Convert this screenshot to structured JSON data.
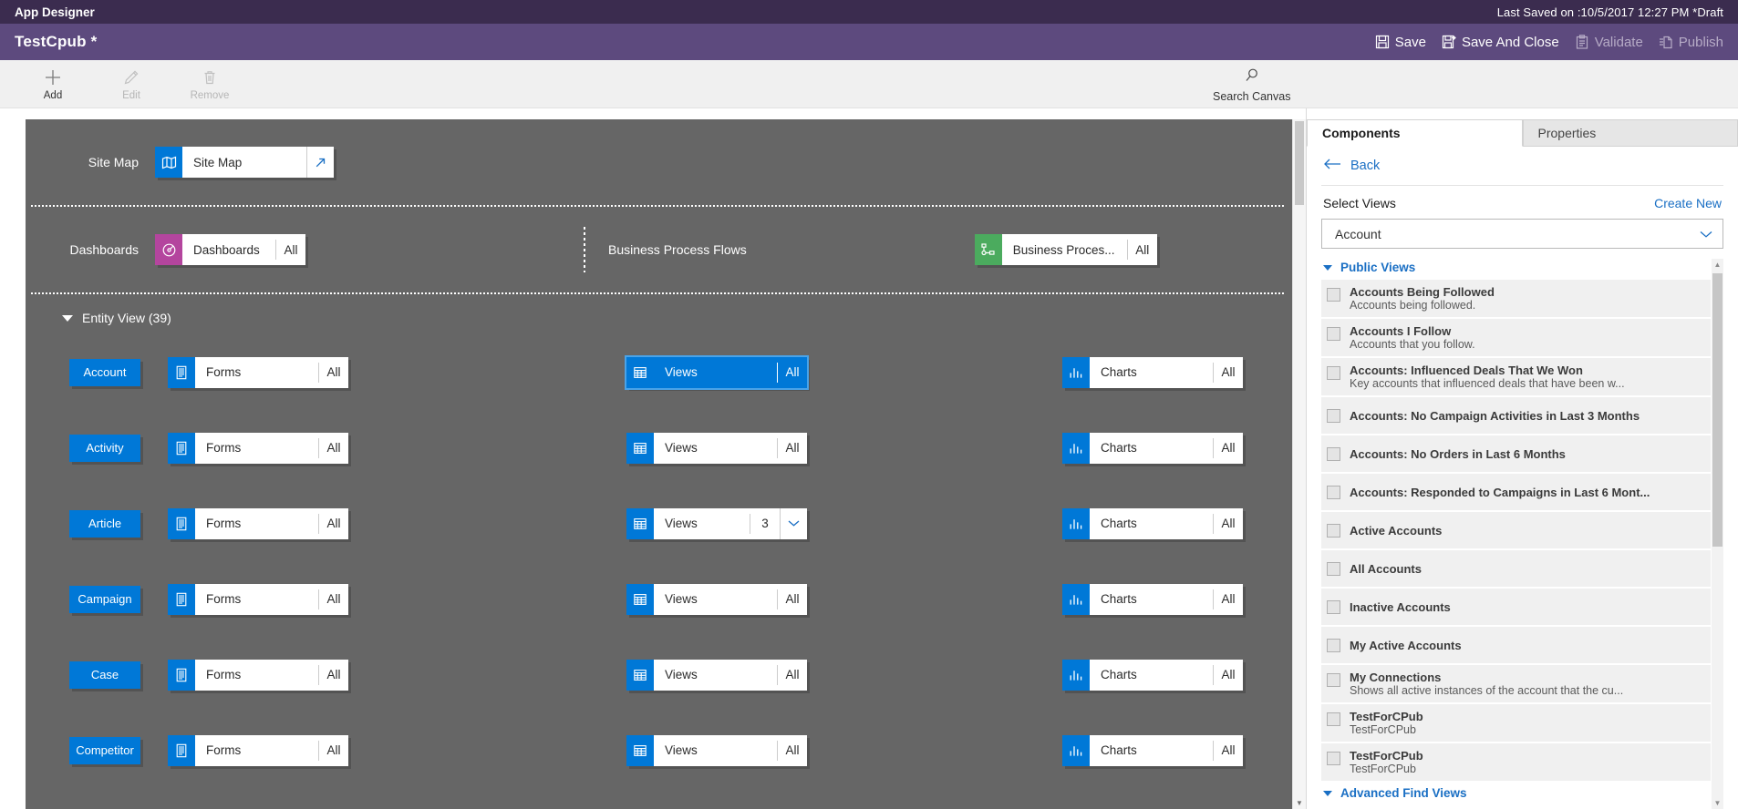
{
  "titlebar": {
    "title": "App Designer",
    "last_saved": "Last Saved on :10/5/2017 12:27 PM *Draft"
  },
  "commandbar": {
    "app_name": "TestCpub *",
    "actions": [
      {
        "label": "Save",
        "icon": "save-icon",
        "enabled": true
      },
      {
        "label": "Save And Close",
        "icon": "save-and-close-icon",
        "enabled": true
      },
      {
        "label": "Validate",
        "icon": "validate-icon",
        "enabled": false
      },
      {
        "label": "Publish",
        "icon": "publish-icon",
        "enabled": false
      }
    ]
  },
  "ribbon": {
    "buttons": [
      {
        "label": "Add",
        "icon": "plus-icon",
        "enabled": true
      },
      {
        "label": "Edit",
        "icon": "pencil-icon",
        "enabled": false
      },
      {
        "label": "Remove",
        "icon": "trash-icon",
        "enabled": false
      }
    ],
    "search_canvas": {
      "label": "Search Canvas",
      "icon": "search-icon"
    }
  },
  "canvas": {
    "sitemap_row": {
      "label": "Site Map",
      "tile": {
        "name": "Site Map",
        "icon": "map-icon",
        "icon_color": "#0078d7",
        "open_icon": "open-arrow-icon"
      }
    },
    "dashboards_row": {
      "label": "Dashboards",
      "tile": {
        "name": "Dashboards",
        "count": "All",
        "icon": "dashboard-icon",
        "icon_color": "#b4459e"
      }
    },
    "bpf_row": {
      "label": "Business Process Flows",
      "tile": {
        "name": "Business Proces...",
        "count": "All",
        "icon": "process-flow-icon",
        "icon_color": "#4bab5e"
      }
    },
    "entity_view": {
      "group_label": "Entity View (39)",
      "column_icons": {
        "forms": "forms-icon",
        "views": "views-grid-icon",
        "charts": "charts-bar-icon"
      },
      "column_labels": {
        "forms": "Forms",
        "views": "Views",
        "charts": "Charts"
      },
      "rows": [
        {
          "entity": "Account",
          "forms_count": "All",
          "views_count": "All",
          "charts_count": "All",
          "views_selected": true,
          "views_has_chevron": false
        },
        {
          "entity": "Activity",
          "forms_count": "All",
          "views_count": "All",
          "charts_count": "All",
          "views_selected": false,
          "views_has_chevron": false
        },
        {
          "entity": "Article",
          "forms_count": "All",
          "views_count": "3",
          "charts_count": "All",
          "views_selected": false,
          "views_has_chevron": true
        },
        {
          "entity": "Campaign",
          "forms_count": "All",
          "views_count": "All",
          "charts_count": "All",
          "views_selected": false,
          "views_has_chevron": false
        },
        {
          "entity": "Case",
          "forms_count": "All",
          "views_count": "All",
          "charts_count": "All",
          "views_selected": false,
          "views_has_chevron": false
        },
        {
          "entity": "Competitor",
          "forms_count": "All",
          "views_count": "All",
          "charts_count": "All",
          "views_selected": false,
          "views_has_chevron": false
        }
      ]
    }
  },
  "panel": {
    "tabs": [
      {
        "label": "Components",
        "active": true
      },
      {
        "label": "Properties",
        "active": false
      }
    ],
    "back_label": "Back",
    "select_label": "Select Views",
    "create_new_label": "Create New",
    "entity_combo_value": "Account",
    "groups": [
      {
        "label": "Public Views",
        "expanded": true,
        "items": [
          {
            "title": "Accounts Being Followed",
            "desc": "Accounts being followed.",
            "checked": false
          },
          {
            "title": "Accounts I Follow",
            "desc": "Accounts that you follow.",
            "checked": false
          },
          {
            "title": "Accounts: Influenced Deals That We Won",
            "desc": "Key accounts that influenced deals that have been w...",
            "checked": false
          },
          {
            "title": "Accounts: No Campaign Activities in Last 3 Months",
            "desc": "",
            "checked": false
          },
          {
            "title": "Accounts: No Orders in Last 6 Months",
            "desc": "",
            "checked": false
          },
          {
            "title": "Accounts: Responded to Campaigns in Last 6 Mont...",
            "desc": "",
            "checked": false
          },
          {
            "title": "Active Accounts",
            "desc": "",
            "checked": false
          },
          {
            "title": "All Accounts",
            "desc": "",
            "checked": false
          },
          {
            "title": "Inactive Accounts",
            "desc": "",
            "checked": false
          },
          {
            "title": "My Active Accounts",
            "desc": "",
            "checked": false
          },
          {
            "title": "My Connections",
            "desc": "Shows all active instances of the account that the cu...",
            "checked": false
          },
          {
            "title": "TestForCPub",
            "desc": "TestForCPub",
            "checked": false
          },
          {
            "title": "TestForCPub",
            "desc": "TestForCPub",
            "checked": false
          }
        ]
      }
    ],
    "advanced_group_label": "Advanced Find Views"
  },
  "colors": {
    "titlebar": "#3b2c4f",
    "commandbar": "#5d4a7e",
    "canvas": "#666666",
    "accent_blue": "#0078d7",
    "link_blue": "#1a6fc4",
    "pink": "#b4459e",
    "green": "#4bab5e"
  }
}
